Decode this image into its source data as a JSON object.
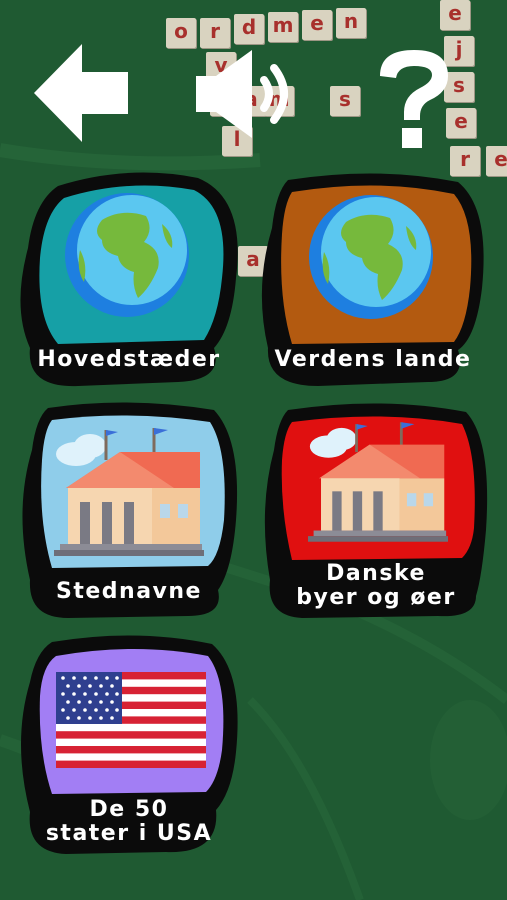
{
  "background": {
    "color": "#1f5a32",
    "letter_tiles": [
      "o",
      "r",
      "d",
      "m",
      "e",
      "n",
      "e",
      "j",
      "s",
      "e",
      "r",
      "e",
      "v",
      "r",
      "a",
      "m",
      "s",
      "l",
      "a",
      "e"
    ]
  },
  "toolbar": {
    "back_icon": "back-arrow-icon",
    "sound_icon": "speaker-icon",
    "help_icon": "question-mark-icon"
  },
  "categories": [
    {
      "label": "Hovedstæder",
      "icon": "globe-icon",
      "color": "#16a0a6"
    },
    {
      "label": "Verdens lande",
      "icon": "globe-icon",
      "color": "#b35a10"
    },
    {
      "label": "Stednavne",
      "icon": "building-icon",
      "color": "#8fcdea"
    },
    {
      "label": "Danske\nbyer og øer",
      "icon": "building-icon",
      "color": "#e01010"
    },
    {
      "label": "De 50\nstater i USA",
      "icon": "us-flag-icon",
      "color": "#a27ef4"
    }
  ]
}
